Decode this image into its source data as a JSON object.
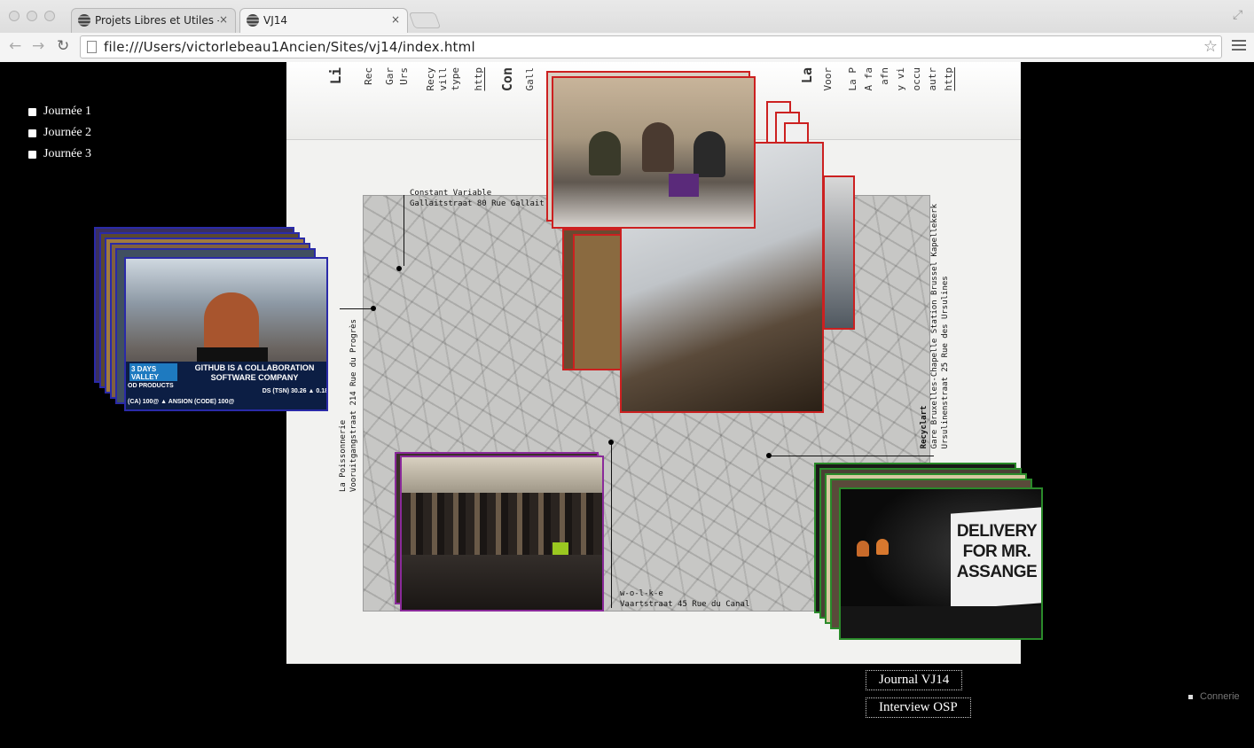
{
  "browser": {
    "tabs": [
      {
        "title": "Projets Libres et Utiles – H",
        "active": false
      },
      {
        "title": "VJ14",
        "active": true
      }
    ],
    "url": "file:///Users/victorlebeau1Ancien/Sites/vj14/index.html",
    "icons": {
      "back": "back-arrow-icon",
      "forward": "forward-arrow-icon",
      "reload": "reload-icon",
      "bookmark": "star-icon",
      "menu": "hamburger-menu-icon",
      "close_tab": "×"
    },
    "glyphs": {
      "close": "×",
      "back": "←",
      "forward": "→",
      "reload": "↻",
      "star": "☆",
      "fullscreen": "⤢"
    }
  },
  "sidebar": {
    "days": [
      {
        "label": "Journée 1"
      },
      {
        "label": "Journée 2"
      },
      {
        "label": "Journée 3"
      }
    ]
  },
  "book": {
    "top_words": [
      "Li",
      "Rec",
      "Gar",
      "Urs",
      "Recy",
      "vill",
      "type",
      "http",
      "Con",
      "Gall",
      "La",
      "Voor",
      "La P",
      "A fa",
      "afn",
      "y vi",
      "occu",
      "autr",
      "http"
    ],
    "map_labels": {
      "constant": "Constant Variable",
      "constant_addr": "Gallaitstraat 80 Rue Gallait",
      "poissonnerie": "La Poissonnerie",
      "poissonnerie_addr": "Vooruitgangstraat 214 Rue du Progrès",
      "recyclart": "Recyclart",
      "recyclart_addr1": "Gare Bruxelles-Chapelle Station Brussel Kapellekerk",
      "recyclart_addr2": "Ursulinenstraat 25 Rue des Ursulines",
      "wolke": "w-o-l-k-e",
      "wolke_addr": "Vaartstraat 45 Rue du Canal"
    }
  },
  "photos": {
    "github_caption": "GITHUB IS A COLLABORATION SOFTWARE COMPANY",
    "github_badge": "3 DAYS VALLEY",
    "github_ticker_1": "OD PRODUCTS",
    "github_ticker_2": "(CA) 100@ ▲ ANSION (CODE) 100@",
    "github_ticker_3": "DS (TSN) 30.26 ▲ 0.18",
    "assange_caption": "DELIVERY FOR MR. ASSANGE",
    "stack_colors": {
      "blue": "#2a2aa8",
      "red": "#cc2020",
      "purple": "#8a2a9a",
      "green": "#2a8a2a"
    }
  },
  "links": {
    "journal": "Journal VJ14",
    "interview": "Interview OSP",
    "connerie": "Connerie"
  }
}
